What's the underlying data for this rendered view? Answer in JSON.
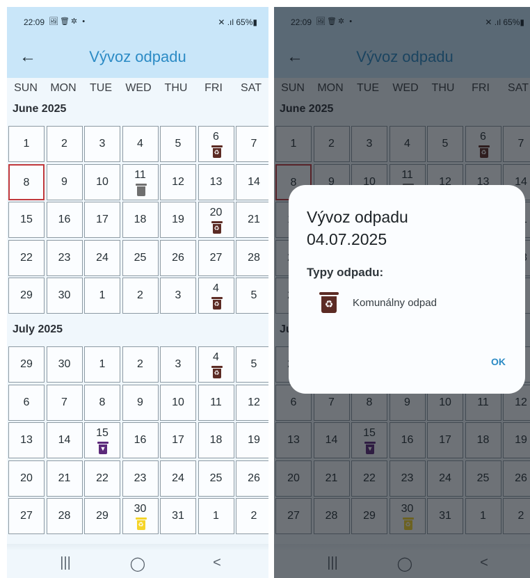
{
  "status": {
    "time": "22:09",
    "icons": "🖼🗑✲ •",
    "battery": "✕ .ıl 65%▮"
  },
  "header": {
    "back_icon": "←",
    "title": "Vývoz odpadu"
  },
  "weekdays": [
    "SUN",
    "MON",
    "TUE",
    "WED",
    "THU",
    "FRI",
    "SAT"
  ],
  "months": [
    {
      "title": "June 2025",
      "weeks": [
        [
          "1",
          "2",
          "3",
          "4",
          "5",
          "6",
          "7"
        ],
        [
          "8",
          "9",
          "10",
          "11",
          "12",
          "13",
          "14"
        ],
        [
          "15",
          "16",
          "17",
          "18",
          "19",
          "20",
          "21"
        ],
        [
          "22",
          "23",
          "24",
          "25",
          "26",
          "27",
          "28"
        ],
        [
          "29",
          "30",
          "1",
          "2",
          "3",
          "4",
          "5"
        ]
      ],
      "selected": [
        [
          1,
          0
        ]
      ],
      "icons": [
        {
          "week": 0,
          "day": 5,
          "type": "brown"
        },
        {
          "week": 1,
          "day": 3,
          "type": "gray"
        },
        {
          "week": 2,
          "day": 5,
          "type": "brown"
        },
        {
          "week": 4,
          "day": 5,
          "type": "brown"
        }
      ]
    },
    {
      "title": "July 2025",
      "weeks": [
        [
          "29",
          "30",
          "1",
          "2",
          "3",
          "4",
          "5"
        ],
        [
          "6",
          "7",
          "8",
          "9",
          "10",
          "11",
          "12"
        ],
        [
          "13",
          "14",
          "15",
          "16",
          "17",
          "18",
          "19"
        ],
        [
          "20",
          "21",
          "22",
          "23",
          "24",
          "25",
          "26"
        ],
        [
          "27",
          "28",
          "29",
          "30",
          "31",
          "1",
          "2"
        ]
      ],
      "selected": [],
      "icons": [
        {
          "week": 0,
          "day": 5,
          "type": "brown"
        },
        {
          "week": 2,
          "day": 2,
          "type": "purple"
        },
        {
          "week": 4,
          "day": 3,
          "type": "yellow"
        }
      ]
    }
  ],
  "nav": {
    "recents": "|||",
    "home": "◯",
    "back": "<"
  },
  "dialog": {
    "title_line1": "Vývoz odpadu",
    "title_line2": "04.07.2025",
    "subtitle": "Typy odpadu:",
    "item_label": "Komunálny odpad",
    "ok_label": "OK"
  },
  "bin_colors": {
    "brown": "#5c2b24",
    "gray": "#6f6f6f",
    "purple": "#5c2a7a",
    "yellow": "#f5d428"
  }
}
